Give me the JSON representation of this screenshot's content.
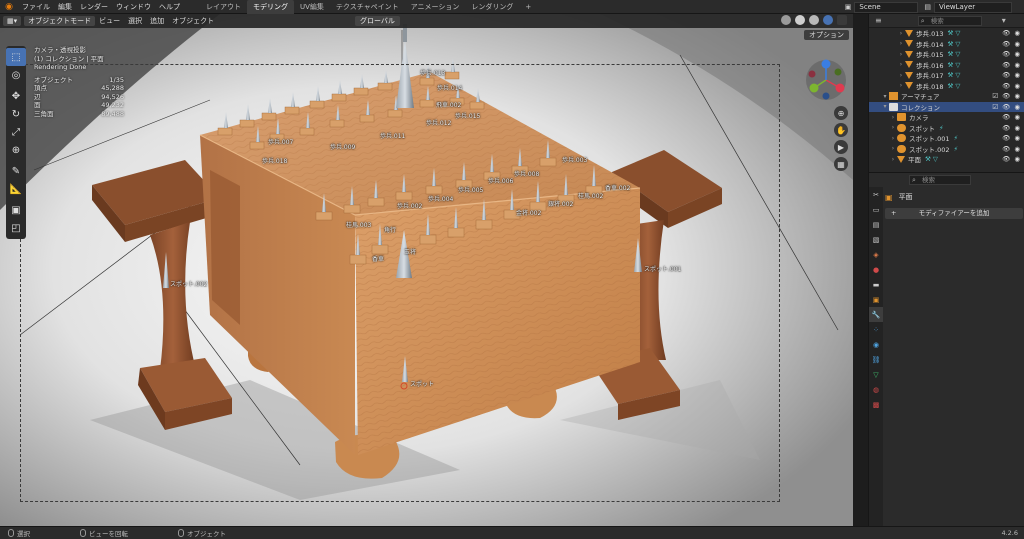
{
  "menubar": {
    "items": [
      "ファイル",
      "編集",
      "レンダー",
      "ウィンドウ",
      "ヘルプ"
    ],
    "workspaces": [
      "レイアウト",
      "モデリング",
      "UV編集",
      "テクスチャペイント",
      "アニメーション",
      "レンダリング"
    ],
    "active_workspace": "モデリング",
    "add_tab": "+",
    "scene": "Scene",
    "view_layer": "ViewLayer"
  },
  "viewport": {
    "mode": "オブジェクトモード",
    "menus": [
      "ビュー",
      "選択",
      "追加",
      "オブジェクト"
    ],
    "orientation": "グローバル",
    "options": "オプション",
    "overlay": {
      "view_name": "カメラ・透視投影",
      "collection": "(1) コレクション | 平面",
      "rendering": "Rendering Done",
      "stats": [
        {
          "label": "オブジェクト",
          "value": "1/35"
        },
        {
          "label": "頂点",
          "value": "45,288"
        },
        {
          "label": "辺",
          "value": "94,526"
        },
        {
          "label": "面",
          "value": "49,232"
        },
        {
          "label": "三角面",
          "value": "89,488"
        }
      ]
    },
    "labels": {
      "fuhyo013": "歩兵.013",
      "fuhyo014": "歩兵.014",
      "hisha002": "飛車.002",
      "fuhyo018": "歩兵.018",
      "fuhyo003": "歩兵.003",
      "fuhyo007": "歩兵.007",
      "fuhyo009": "歩兵.009",
      "fuhyo011": "歩兵.011",
      "fuhyo012": "歩兵.012",
      "fuhyo015": "歩兵.015",
      "fuhyo008": "歩兵.008",
      "fuhyo006": "歩兵.006",
      "fuhyo005": "歩兵.005",
      "fuhyo004": "歩兵.004",
      "fuhyo002": "歩兵.002",
      "keima002": "桂馬.002",
      "keima003": "桂馬.003",
      "kyosha002": "香車.002",
      "kinsho002": "金将.002",
      "ginsho002": "銀将.002",
      "kakugyo": "角行",
      "kyosha": "香車",
      "gyokusho": "玉将",
      "spot002": "スポット.002",
      "spot001": "スポット.001",
      "spot": "スポット"
    }
  },
  "statusbar": {
    "select": "選択",
    "rotate": "ビューを回転",
    "object": "オブジェクト",
    "version": "4.2.6"
  },
  "outliner": {
    "search_placeholder": "検索",
    "rows": [
      {
        "name": "歩兵.013",
        "indent": 3,
        "type": "mesh",
        "selected": false
      },
      {
        "name": "歩兵.014",
        "indent": 3,
        "type": "mesh",
        "selected": false
      },
      {
        "name": "歩兵.015",
        "indent": 3,
        "type": "mesh",
        "selected": false
      },
      {
        "name": "歩兵.016",
        "indent": 3,
        "type": "mesh",
        "selected": false
      },
      {
        "name": "歩兵.017",
        "indent": 3,
        "type": "mesh",
        "selected": false
      },
      {
        "name": "歩兵.018",
        "indent": 3,
        "type": "mesh",
        "selected": false
      },
      {
        "name": "アーマチュア",
        "indent": 1,
        "type": "armature",
        "selected": false
      },
      {
        "name": "コレクション",
        "indent": 1,
        "type": "collection",
        "selected": true
      },
      {
        "name": "カメラ",
        "indent": 2,
        "type": "camera",
        "selected": false
      },
      {
        "name": "スポット",
        "indent": 2,
        "type": "light",
        "selected": false
      },
      {
        "name": "スポット.001",
        "indent": 2,
        "type": "light",
        "selected": false
      },
      {
        "name": "スポット.002",
        "indent": 2,
        "type": "light",
        "selected": false
      },
      {
        "name": "平面",
        "indent": 2,
        "type": "mesh",
        "selected": false
      }
    ]
  },
  "properties": {
    "search_placeholder": "検索",
    "object_name": "平面",
    "add_modifier": "モディファイアーを追加"
  },
  "colors": {
    "accent": "#4772b3",
    "selected_row": "#334d80",
    "mesh_icon": "#e0932e",
    "modifier_icon": "#4fc6c6"
  }
}
